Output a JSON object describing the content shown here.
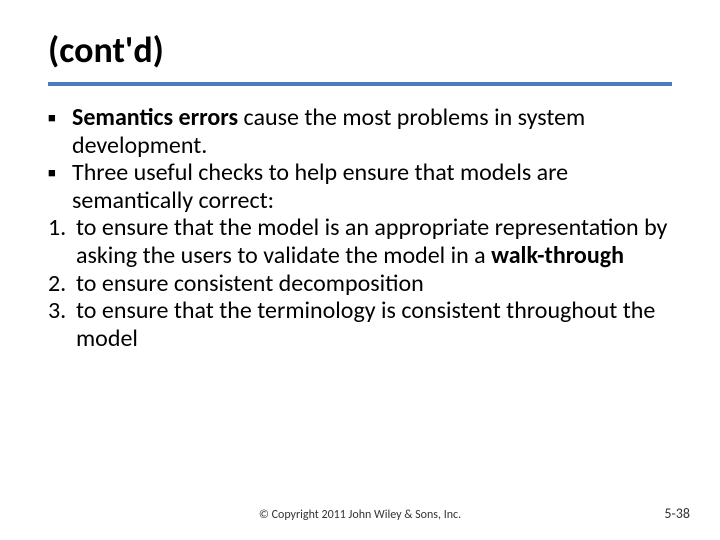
{
  "title": "(cont'd)",
  "bullets": [
    {
      "runs": [
        {
          "text": "Semantics errors",
          "bold": true
        },
        {
          "text": " cause the most problems in system development.",
          "bold": false
        }
      ]
    },
    {
      "runs": [
        {
          "text": "Three useful checks to help ensure that models are semantically correct:",
          "bold": false
        }
      ]
    }
  ],
  "numbers": [
    {
      "n": "1.",
      "runs": [
        {
          "text": " to ensure that the model is an appropriate representation by asking the users to validate the model in a ",
          "bold": false
        },
        {
          "text": "walk-through",
          "bold": true
        }
      ]
    },
    {
      "n": "2.",
      "runs": [
        {
          "text": " to ensure consistent decomposition",
          "bold": false
        }
      ]
    },
    {
      "n": "3.",
      "runs": [
        {
          "text": " to ensure that the terminology is consistent throughout the model",
          "bold": false
        }
      ]
    }
  ],
  "footer": "© Copyright 2011 John Wiley & Sons, Inc.",
  "page": "5-38"
}
